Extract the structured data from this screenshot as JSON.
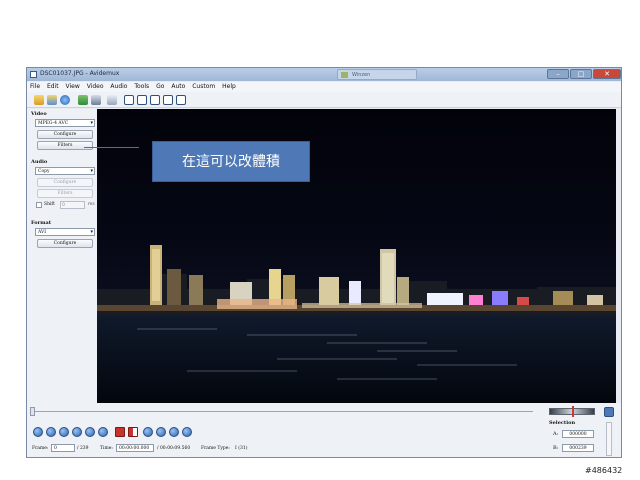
{
  "window": {
    "title": "DSC01037.JPG - Avidemux",
    "background_window_title": "Winzen"
  },
  "menu": [
    "File",
    "Edit",
    "View",
    "Video",
    "Audio",
    "Tools",
    "Go",
    "Auto",
    "Custom",
    "Help"
  ],
  "left_panel": {
    "video": {
      "section_label": "Video",
      "codec": "MPEG-4 AVC",
      "configure_label": "Configure",
      "filters_label": "Filters"
    },
    "audio": {
      "section_label": "Audio",
      "codec": "Copy",
      "configure_label": "Configure",
      "filters_label": "Filters",
      "shift_label": "Shift",
      "shift_value": "0",
      "shift_unit": "ms"
    },
    "format": {
      "section_label": "Format",
      "container": "AVI",
      "configure_label": "Configure"
    }
  },
  "annotation": {
    "text": "在這可以改體積",
    "color": "#4f79b6"
  },
  "status": {
    "frame_label": "Frame:",
    "frame_value": "0",
    "frame_total": "/ 239",
    "time_label": "Time:",
    "time_value": "00:00:00.000",
    "time_total": "/ 00:00:09.560",
    "frame_type_label": "Frame Type:",
    "frame_type_value": "I (31)"
  },
  "selection": {
    "title": "Selection",
    "a_label": "A:",
    "a_value": "000000",
    "b_label": "B:",
    "b_value": "000239"
  },
  "watermark": "#486432",
  "icons": {
    "toolbar": [
      "open-icon",
      "open-append-icon",
      "info-icon",
      "save-icon",
      "save-video-icon",
      "calculator-icon",
      "view-input-icon",
      "view-output-icon",
      "side-by-side-icon",
      "preview-split-icon",
      "preview-full-icon"
    ],
    "playback": [
      "play-icon",
      "stop-icon",
      "prev-frame-icon",
      "next-frame-icon",
      "prev-keyframe-icon",
      "next-keyframe-icon",
      "mark-a-icon",
      "mark-b-icon",
      "prev-black-icon",
      "next-black-icon",
      "first-frame-icon",
      "last-frame-icon"
    ]
  }
}
